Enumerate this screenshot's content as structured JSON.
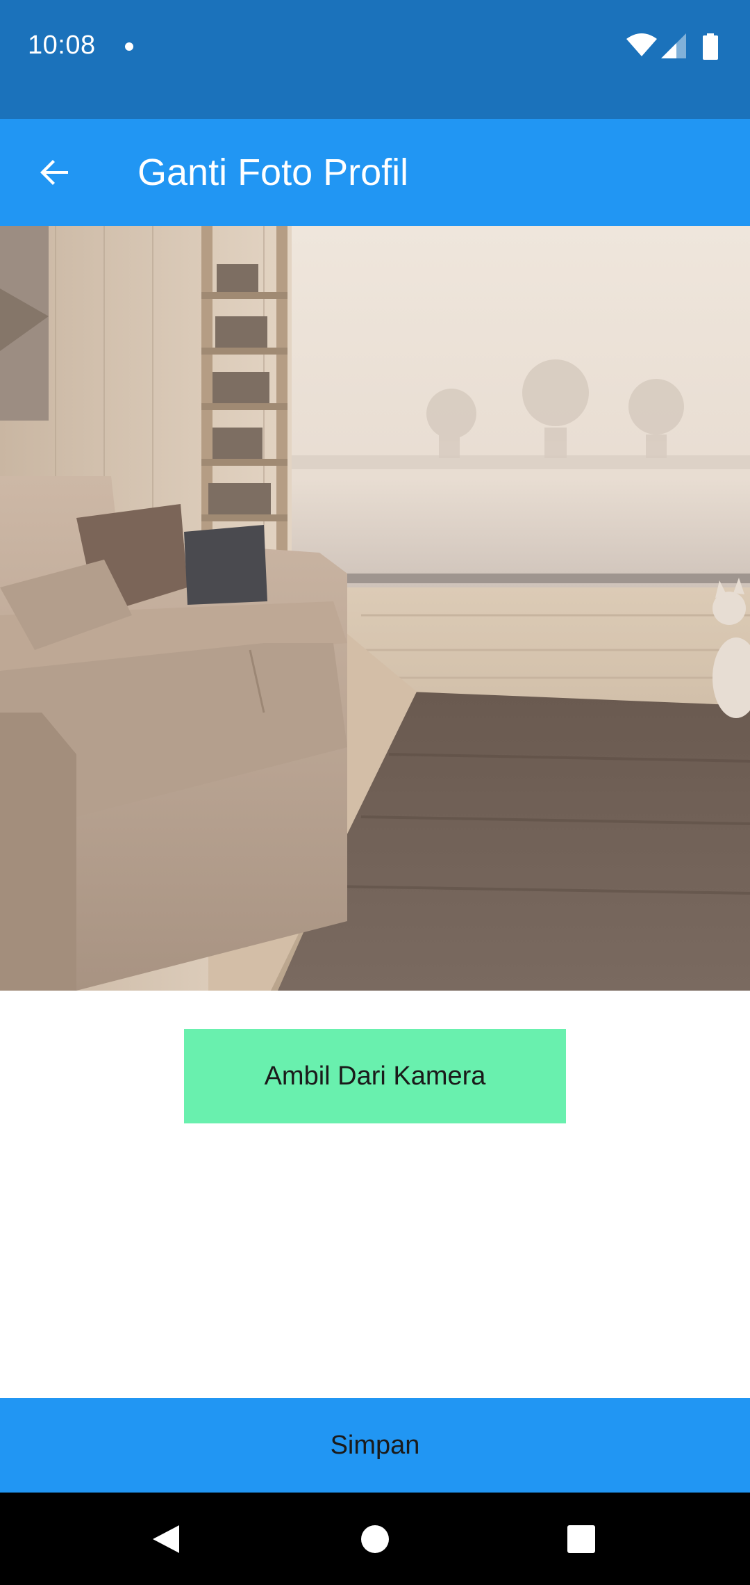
{
  "status_bar": {
    "time": "10:08",
    "icons": [
      "notification-dot-icon",
      "wifi-icon",
      "cell-signal-icon",
      "battery-icon"
    ]
  },
  "app_bar": {
    "title": "Ganti Foto Profil",
    "back_icon": "arrow-back-icon",
    "background": "#2196f3"
  },
  "photo": {
    "subject": "profile-photo-preview"
  },
  "camera_button": {
    "label": "Ambil Dari Kamera",
    "background": "#69f0ae"
  },
  "save_button": {
    "label": "Simpan",
    "background": "#2196f3"
  },
  "nav_bar": {
    "icons": [
      "nav-back-icon",
      "nav-home-icon",
      "nav-recents-icon"
    ]
  },
  "colors": {
    "status_bar": "#1b72bb",
    "primary": "#2196f3",
    "accent": "#69f0ae"
  }
}
